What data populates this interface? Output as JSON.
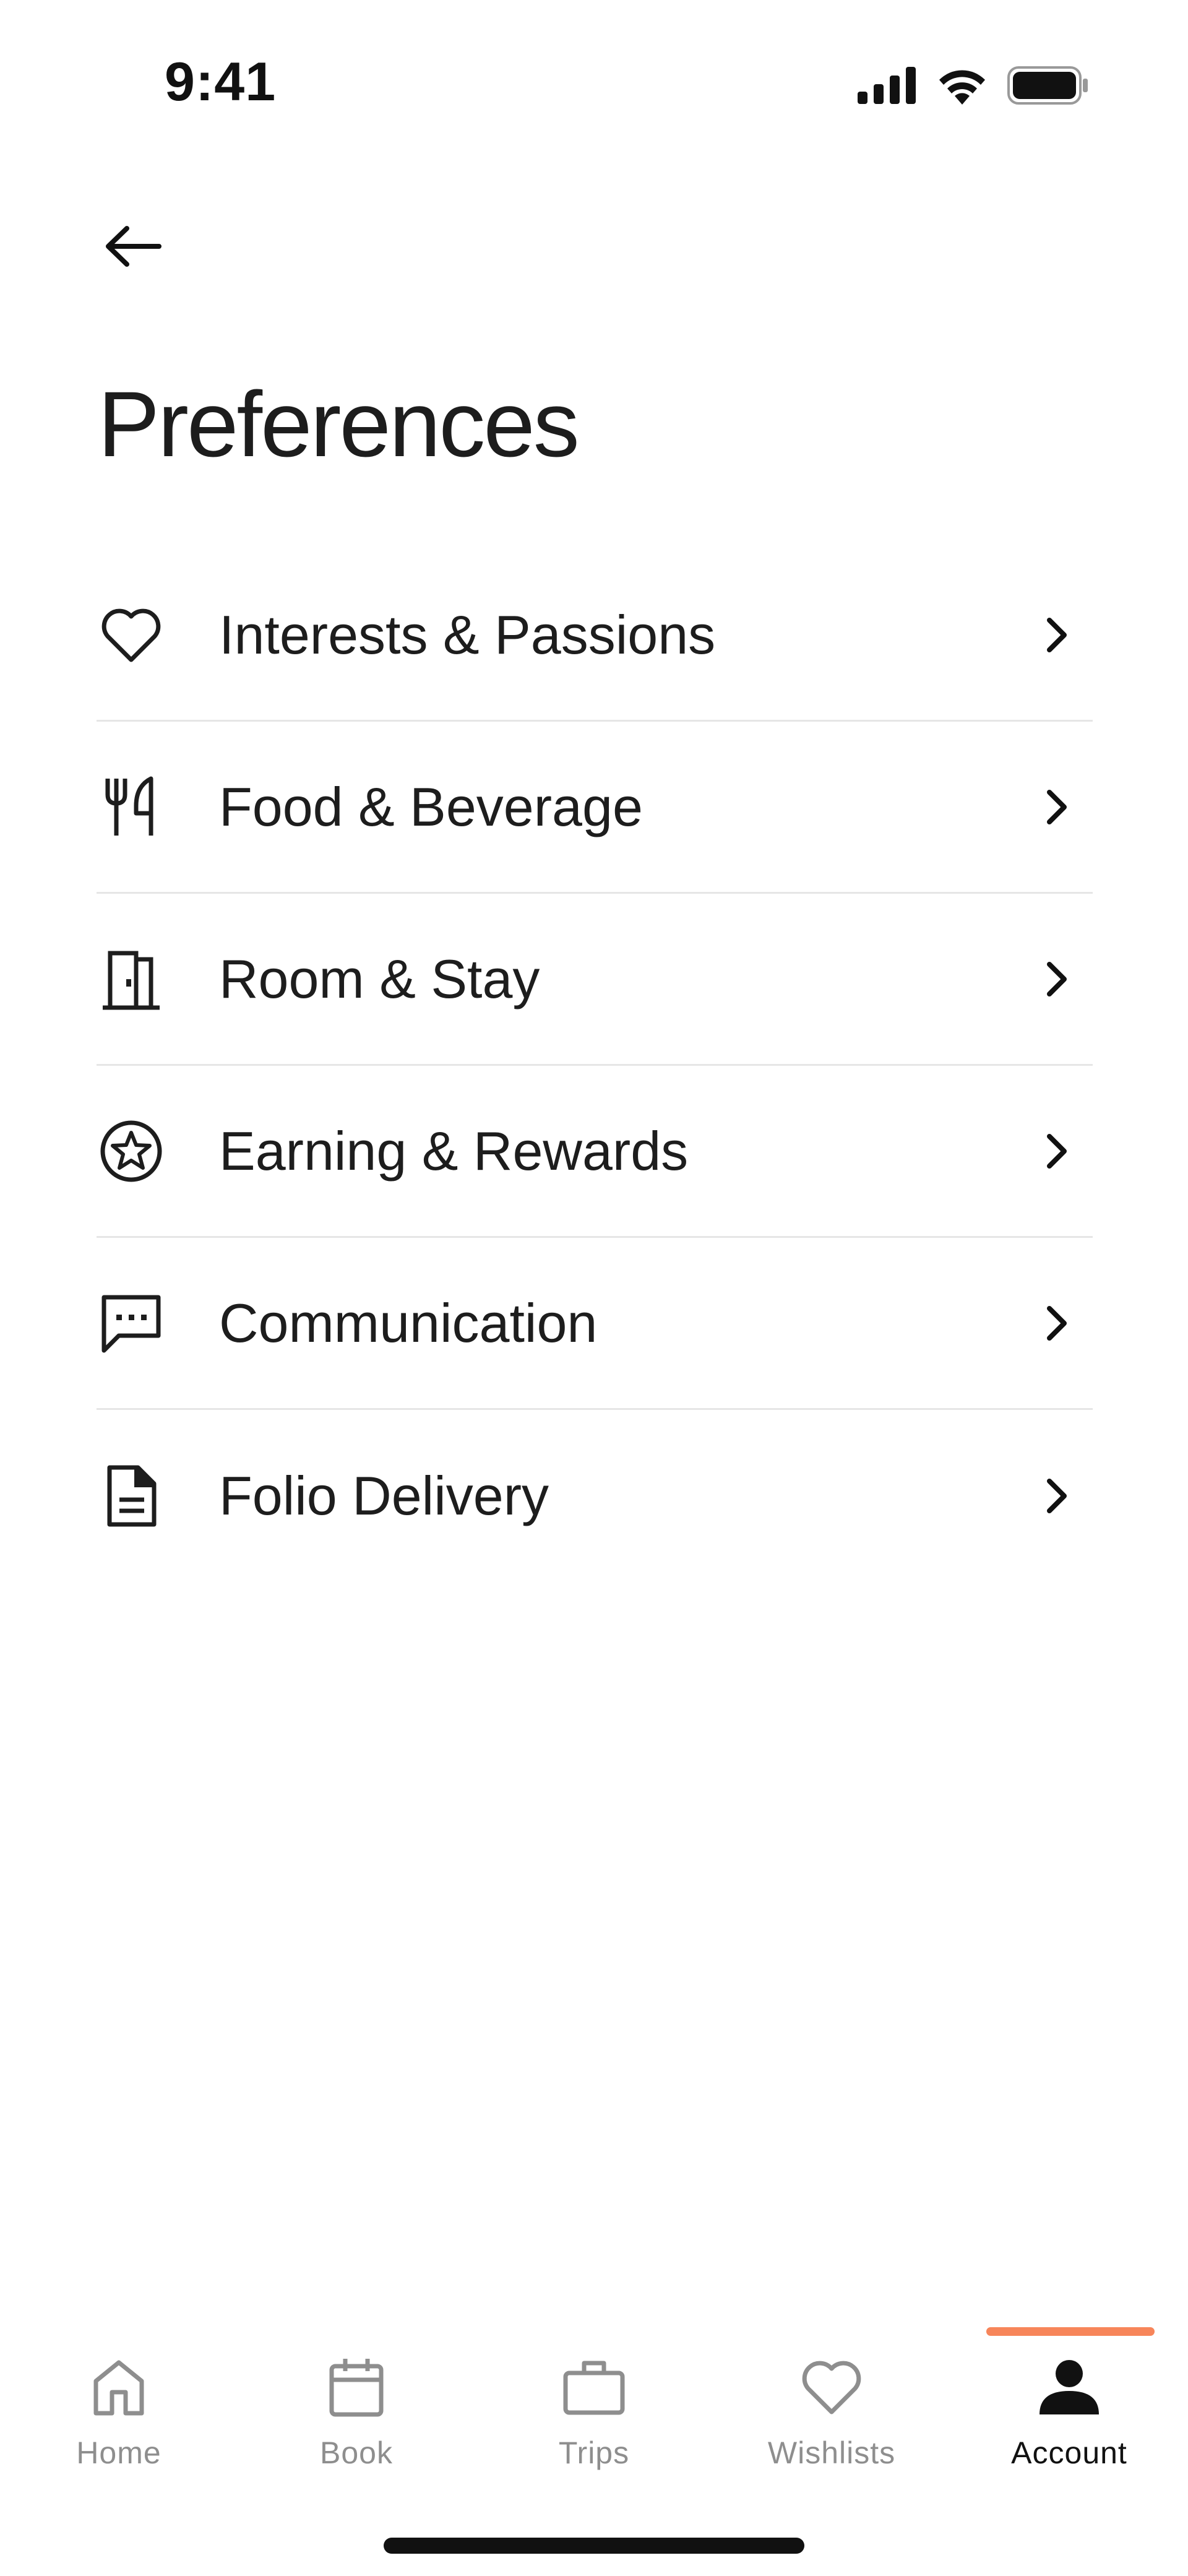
{
  "status_bar": {
    "time": "9:41"
  },
  "header": {
    "title": "Preferences"
  },
  "preferences": [
    {
      "label": "Interests & Passions",
      "icon": "heart-icon"
    },
    {
      "label": "Food & Beverage",
      "icon": "fork-knife-icon"
    },
    {
      "label": "Room & Stay",
      "icon": "door-icon"
    },
    {
      "label": "Earning & Rewards",
      "icon": "star-badge-icon"
    },
    {
      "label": "Communication",
      "icon": "chat-bubble-icon"
    },
    {
      "label": "Folio Delivery",
      "icon": "document-icon"
    }
  ],
  "tab_bar": {
    "items": [
      {
        "label": "Home",
        "icon": "home-icon"
      },
      {
        "label": "Book",
        "icon": "calendar-icon"
      },
      {
        "label": "Trips",
        "icon": "briefcase-icon"
      },
      {
        "label": "Wishlists",
        "icon": "heart-icon"
      },
      {
        "label": "Account",
        "icon": "person-icon"
      }
    ],
    "active": "Account",
    "accent_color": "#f7855a"
  }
}
